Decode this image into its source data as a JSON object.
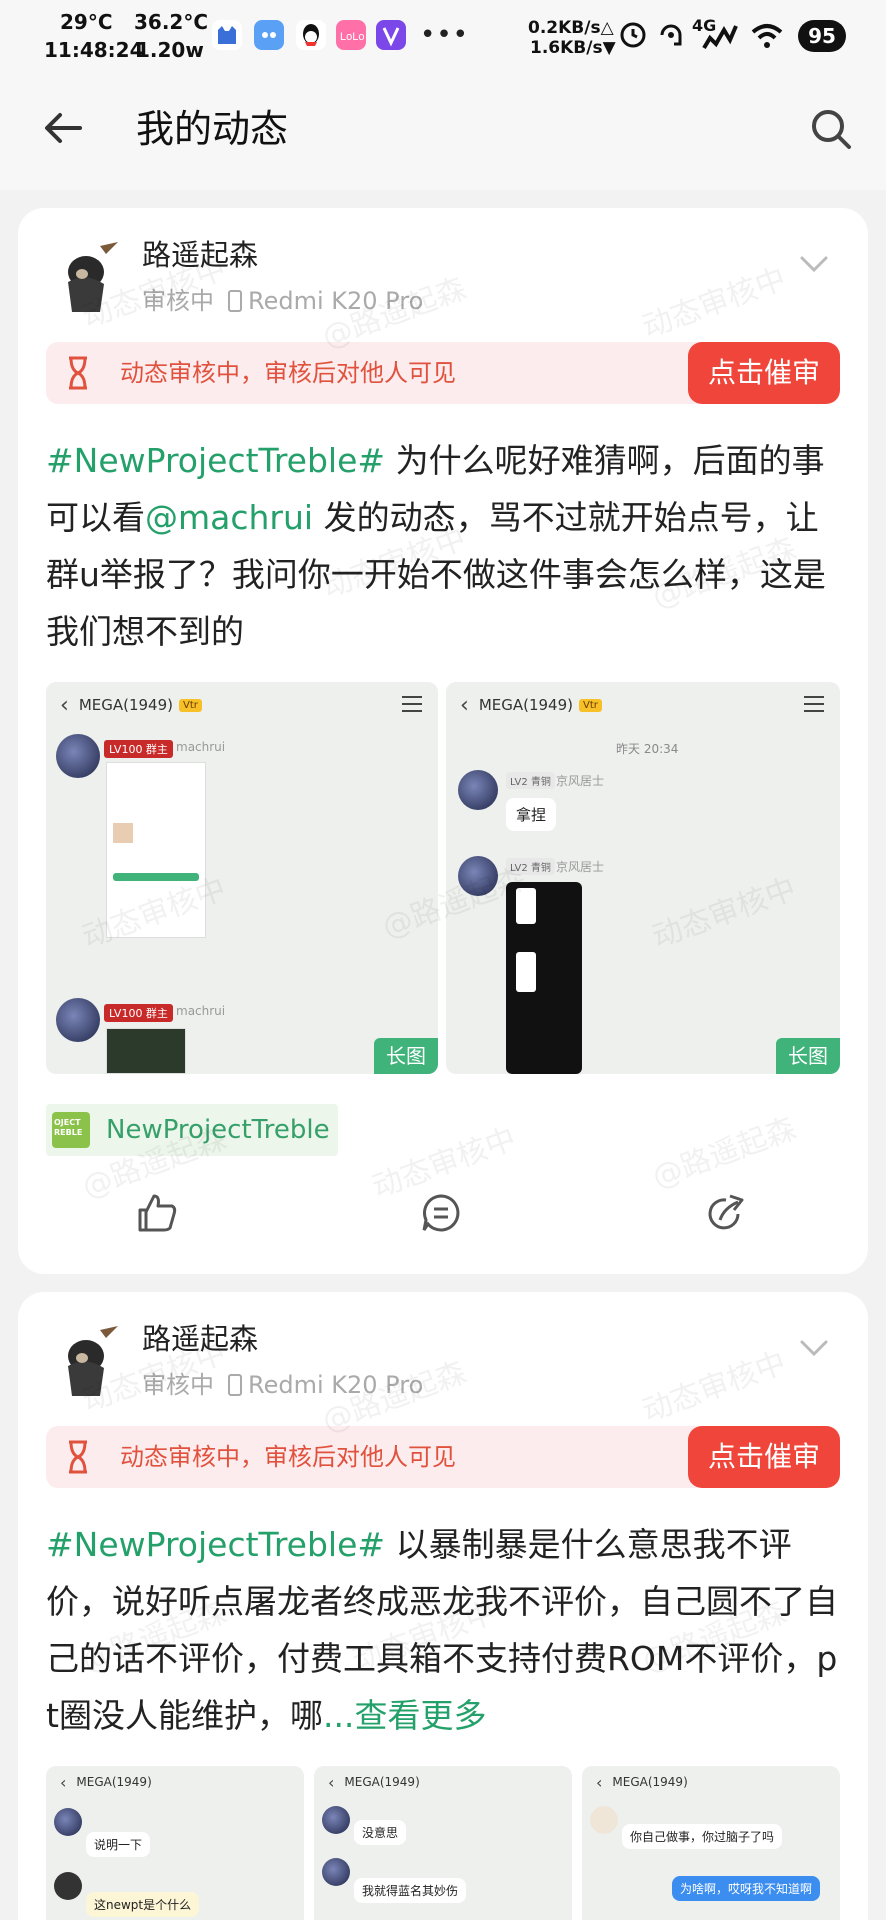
{
  "status_bar": {
    "temp1": "29°C",
    "temp2": "36.2°C",
    "time": "11:48:24",
    "power": "1.20w",
    "net_up": "0.2KB/s△",
    "net_down": "1.6KB/s▼",
    "network": "4G",
    "battery": "95",
    "more": "•••"
  },
  "header": {
    "title": "我的动态"
  },
  "posts": [
    {
      "author": "路遥起森",
      "status": "审核中",
      "device": "Redmi K20 Pro",
      "review_notice": "动态审核中，审核后对他人可见",
      "urge_button": "点击催审",
      "tag": "#NewProjectTreble#",
      "text_a": "为什么呢好难猜啊，后面的事可以看",
      "mention": "@machrui",
      "text_b": "发的动态，骂不过就开始点号，让群u举报了？我问你一开始不做这件事会怎么样，这是我们想不到的",
      "images": [
        {
          "group_name": "MEGA(1949)",
          "level_tag": "LV100 群主",
          "sender": "machrui",
          "badge": "长图"
        },
        {
          "group_name": "MEGA(1949)",
          "time": "昨天 20:34",
          "level_tag": "LV2 青铜",
          "sender": "京风居士",
          "message": "拿捏",
          "badge": "长图"
        }
      ],
      "topic": "NewProjectTreble"
    },
    {
      "author": "路遥起森",
      "status": "审核中",
      "device": "Redmi K20 Pro",
      "review_notice": "动态审核中，审核后对他人可见",
      "urge_button": "点击催审",
      "tag": "#NewProjectTreble#",
      "text_a": "以暴制暴是什么意思我不评价，说好听点屠龙者终成恶龙我不评价，自己圆不了自己的话不评价，付费工具箱不支持付费ROM不评价，pt圈没人能维护，哪",
      "ellipsis": "...",
      "more_link": "查看更多",
      "images": [
        {
          "group_name": "MEGA(1949)",
          "messages": [
            "说明一下",
            "这newpt是个什么"
          ]
        },
        {
          "group_name": "MEGA(1949)",
          "messages": [
            "没意思",
            "我就得蓝名其妙伤"
          ]
        },
        {
          "group_name": "MEGA(1949)",
          "messages": [
            "你自己做事，你过脑子了吗",
            "为啥啊，哎呀我不知道啊"
          ]
        }
      ]
    }
  ],
  "watermarks": [
    "动态审核中",
    "@路遥起森"
  ],
  "colors": {
    "accent_green": "#24a06a",
    "urge_red": "#f0453a",
    "notice_bg": "#fdeced",
    "notice_text": "#e0523e"
  }
}
